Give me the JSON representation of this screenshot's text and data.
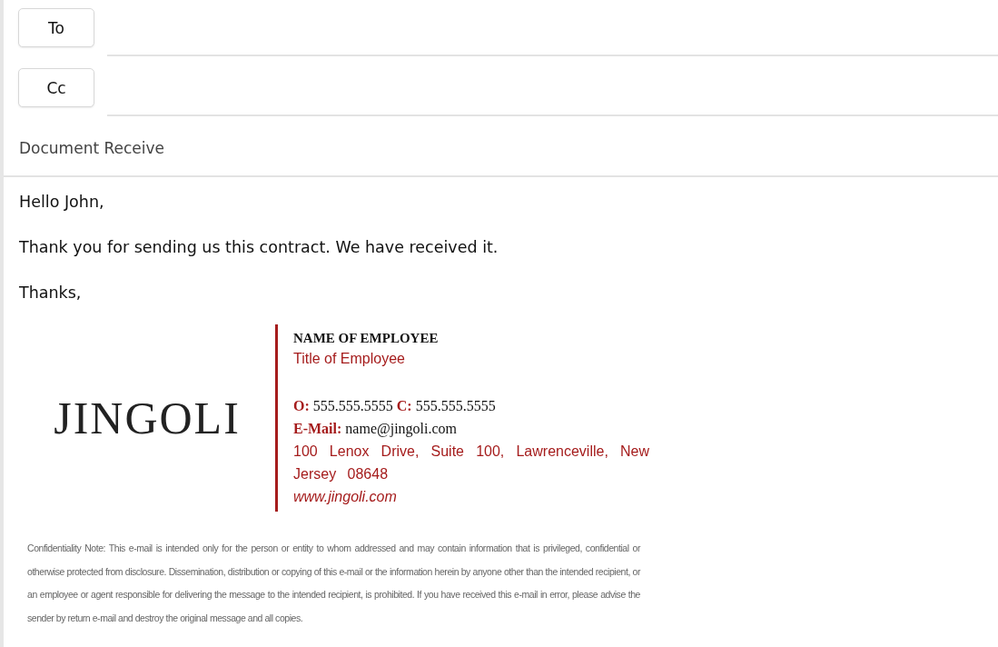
{
  "recipients": [
    {
      "label": "To"
    },
    {
      "label": "Cc"
    }
  ],
  "subject": "Document Receive",
  "body": [
    "Hello John,",
    "Thank you for sending us this contract. We have received it.",
    "Thanks,"
  ],
  "signature": {
    "logo": "JINGOLI",
    "name": "NAME OF EMPLOYEE",
    "title": "Title of Employee",
    "phones": [
      {
        "label": "O:",
        "value": "555.555.5555"
      },
      {
        "label": "C:",
        "value": "555.555.5555"
      }
    ],
    "email": {
      "label": "E-Mail:",
      "value": "name@jingoli.com"
    },
    "address": "100 Lenox Drive, Suite 100, Lawrenceville, New Jersey 08648",
    "website": "www.jingoli.com"
  },
  "disclaimer": "Confidentiality Note: This e-mail is intended only for the person or entity to whom addressed and may contain information that is privileged, confidential or otherwise protected from disclosure.  Dissemination, distribution or copying of this e-mail or the information herein by anyone other than the intended recipient, or an employee or agent responsible for delivering the message to the intended recipient, is prohibited. If you have received this e-mail in error, please advise the sender by return e-mail and destroy the original message and all copies."
}
